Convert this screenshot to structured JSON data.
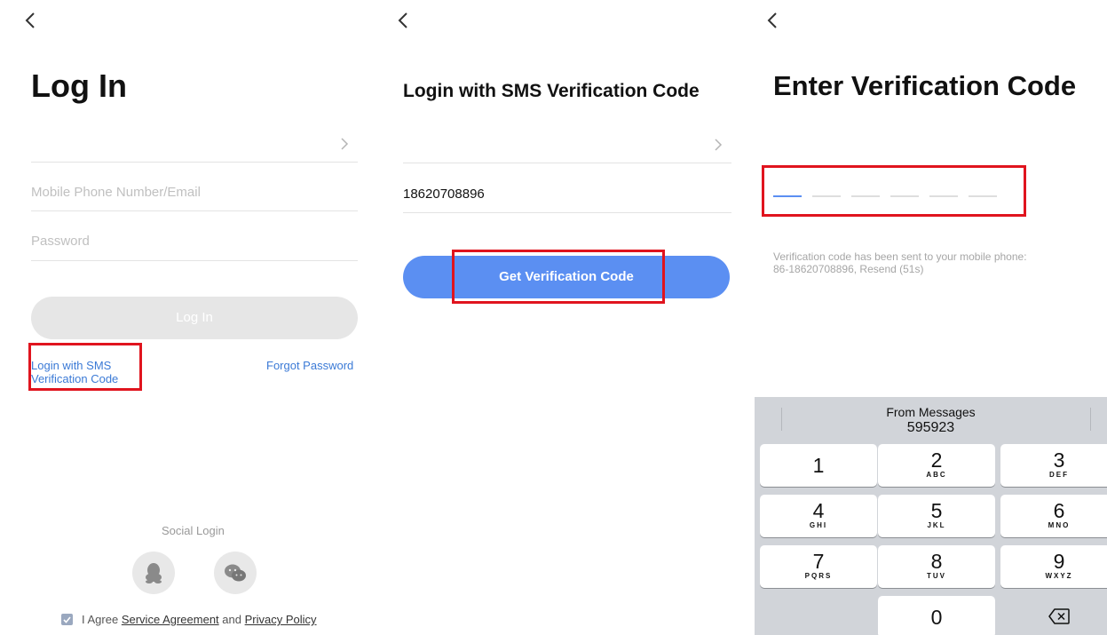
{
  "screen1": {
    "title": "Log In",
    "phone_placeholder": "Mobile Phone Number/Email",
    "password_placeholder": "Password",
    "login_button": "Log In",
    "sms_link": "Login with SMS Verification Code",
    "forgot_link": "Forgot Password",
    "social_title": "Social Login",
    "social_icons": [
      "qq-icon",
      "wechat-icon"
    ],
    "agree_prefix": "I Agree",
    "service_agreement": "Service Agreement",
    "agree_and": "and",
    "privacy_policy": "Privacy Policy"
  },
  "screen2": {
    "title": "Login with SMS Verification Code",
    "phone_value": "18620708896",
    "get_code_button": "Get Verification Code"
  },
  "screen3": {
    "title": "Enter Verification Code",
    "code_slots": 6,
    "hint_line1": "Verification code has been sent to your mobile phone:",
    "hint_line2": "86-18620708896, Resend (51s)",
    "keyboard": {
      "suggestion_label": "From Messages",
      "suggestion_code": "595923",
      "keys": [
        {
          "num": "1",
          "letters": ""
        },
        {
          "num": "2",
          "letters": "ABC"
        },
        {
          "num": "3",
          "letters": "DEF"
        },
        {
          "num": "4",
          "letters": "GHI"
        },
        {
          "num": "5",
          "letters": "JKL"
        },
        {
          "num": "6",
          "letters": "MNO"
        },
        {
          "num": "7",
          "letters": "PQRS"
        },
        {
          "num": "8",
          "letters": "TUV"
        },
        {
          "num": "9",
          "letters": "WXYZ"
        },
        {
          "num": "0",
          "letters": ""
        }
      ]
    }
  },
  "colors": {
    "accent_blue": "#5b8ff2",
    "link_blue": "#3b7ad6",
    "highlight_red": "#e0141e"
  }
}
